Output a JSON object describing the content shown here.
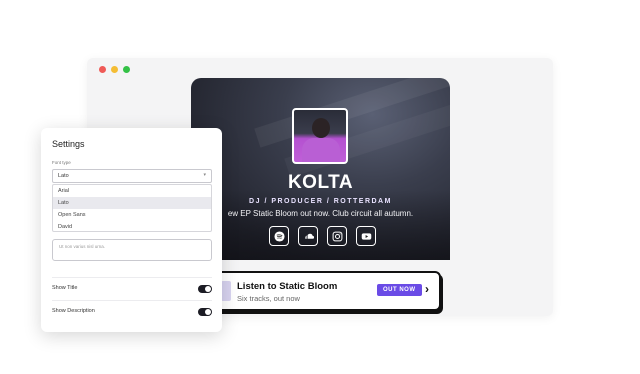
{
  "profile": {
    "name": "KOLTA",
    "tagline": "DJ / PRODUCER / ROTTERDAM",
    "announcement": "ew EP Static Bloom out now. Club circuit all autumn.",
    "socials": [
      {
        "icon": "spotify-icon"
      },
      {
        "icon": "soundcloud-icon"
      },
      {
        "icon": "instagram-icon"
      },
      {
        "icon": "youtube-icon"
      }
    ]
  },
  "cta": {
    "title": "Listen to Static Bloom",
    "subtitle": "Six tracks, out now",
    "badge": "OUT NOW",
    "arrow": "›",
    "badge_color": "#6a4be6"
  },
  "settings": {
    "title": "Settings",
    "font_type_label": "Font type",
    "font_selected": "Lato",
    "font_options": [
      "Arial",
      "Lato",
      "Open Sans",
      "David"
    ],
    "textarea_placeholder": "Ut non varius nisl urna.",
    "show_title_label": "Show Title",
    "show_title_on": true,
    "show_description_label": "Show Description",
    "show_description_on": true
  }
}
